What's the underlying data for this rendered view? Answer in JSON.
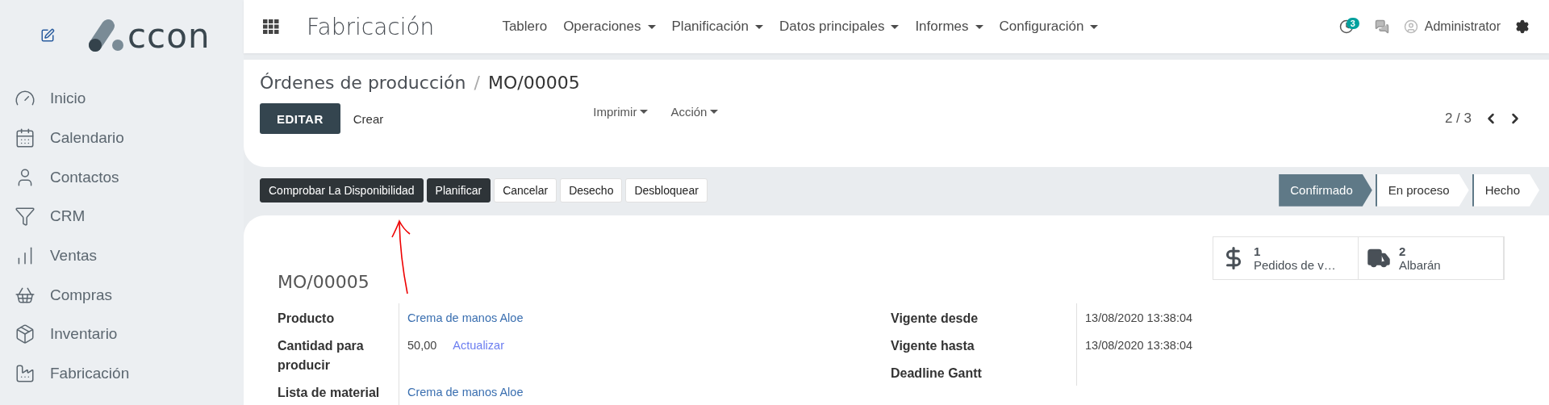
{
  "brand": {
    "logo_text": "ccon"
  },
  "sidebar": {
    "items": [
      {
        "label": "Inicio"
      },
      {
        "label": "Calendario"
      },
      {
        "label": "Contactos"
      },
      {
        "label": "CRM"
      },
      {
        "label": "Ventas"
      },
      {
        "label": "Compras"
      },
      {
        "label": "Inventario"
      },
      {
        "label": "Fabricación"
      }
    ]
  },
  "navbar": {
    "app_title": "Fabricación",
    "menus": [
      {
        "label": "Tablero",
        "dropdown": false
      },
      {
        "label": "Operaciones",
        "dropdown": true
      },
      {
        "label": "Planificación",
        "dropdown": true
      },
      {
        "label": "Datos principales",
        "dropdown": true
      },
      {
        "label": "Informes",
        "dropdown": true
      },
      {
        "label": "Configuración",
        "dropdown": true
      }
    ],
    "activity_badge": "3",
    "user": "Administrator"
  },
  "control_panel": {
    "breadcrumb": [
      {
        "label": "Órdenes de producción"
      },
      {
        "label": "MO/00005"
      }
    ],
    "separator": "/",
    "edit_button": "EDITAR",
    "create_button": "Crear",
    "dropdowns": [
      {
        "label": "Imprimir"
      },
      {
        "label": "Acción"
      }
    ],
    "pager": "2 / 3"
  },
  "header": {
    "buttons": [
      {
        "label": "Comprobar La Disponibilidad",
        "kind": "primary"
      },
      {
        "label": "Planificar",
        "kind": "primary"
      },
      {
        "label": "Cancelar",
        "kind": "secondary"
      },
      {
        "label": "Desecho",
        "kind": "secondary"
      },
      {
        "label": "Desbloquear",
        "kind": "secondary"
      }
    ],
    "stages": [
      {
        "label": "Confirmado",
        "selected": true
      },
      {
        "label": "En proceso",
        "selected": false
      },
      {
        "label": "Hecho",
        "selected": false
      }
    ]
  },
  "sheet": {
    "title": "MO/00005",
    "smart_buttons": [
      {
        "kind": "dollar",
        "count": "1",
        "label": "Pedidos de v…"
      },
      {
        "kind": "truck",
        "count": "2",
        "label": "Albarán"
      }
    ],
    "left_fields": [
      {
        "label": "Producto",
        "value": "Crema de manos Aloe",
        "kind": "link"
      },
      {
        "label": "Cantidad para producir",
        "value": "50,00",
        "kind": "text",
        "action": "Actualizar"
      },
      {
        "label": "Lista de material",
        "value": "Crema de manos Aloe",
        "kind": "link"
      }
    ],
    "right_fields": [
      {
        "label": "Vigente desde",
        "value": "13/08/2020 13:38:04",
        "kind": "text"
      },
      {
        "label": "Vigente hasta",
        "value": "13/08/2020 13:38:04",
        "kind": "text"
      },
      {
        "label": "Deadline Gantt",
        "kind": "empty"
      }
    ]
  }
}
